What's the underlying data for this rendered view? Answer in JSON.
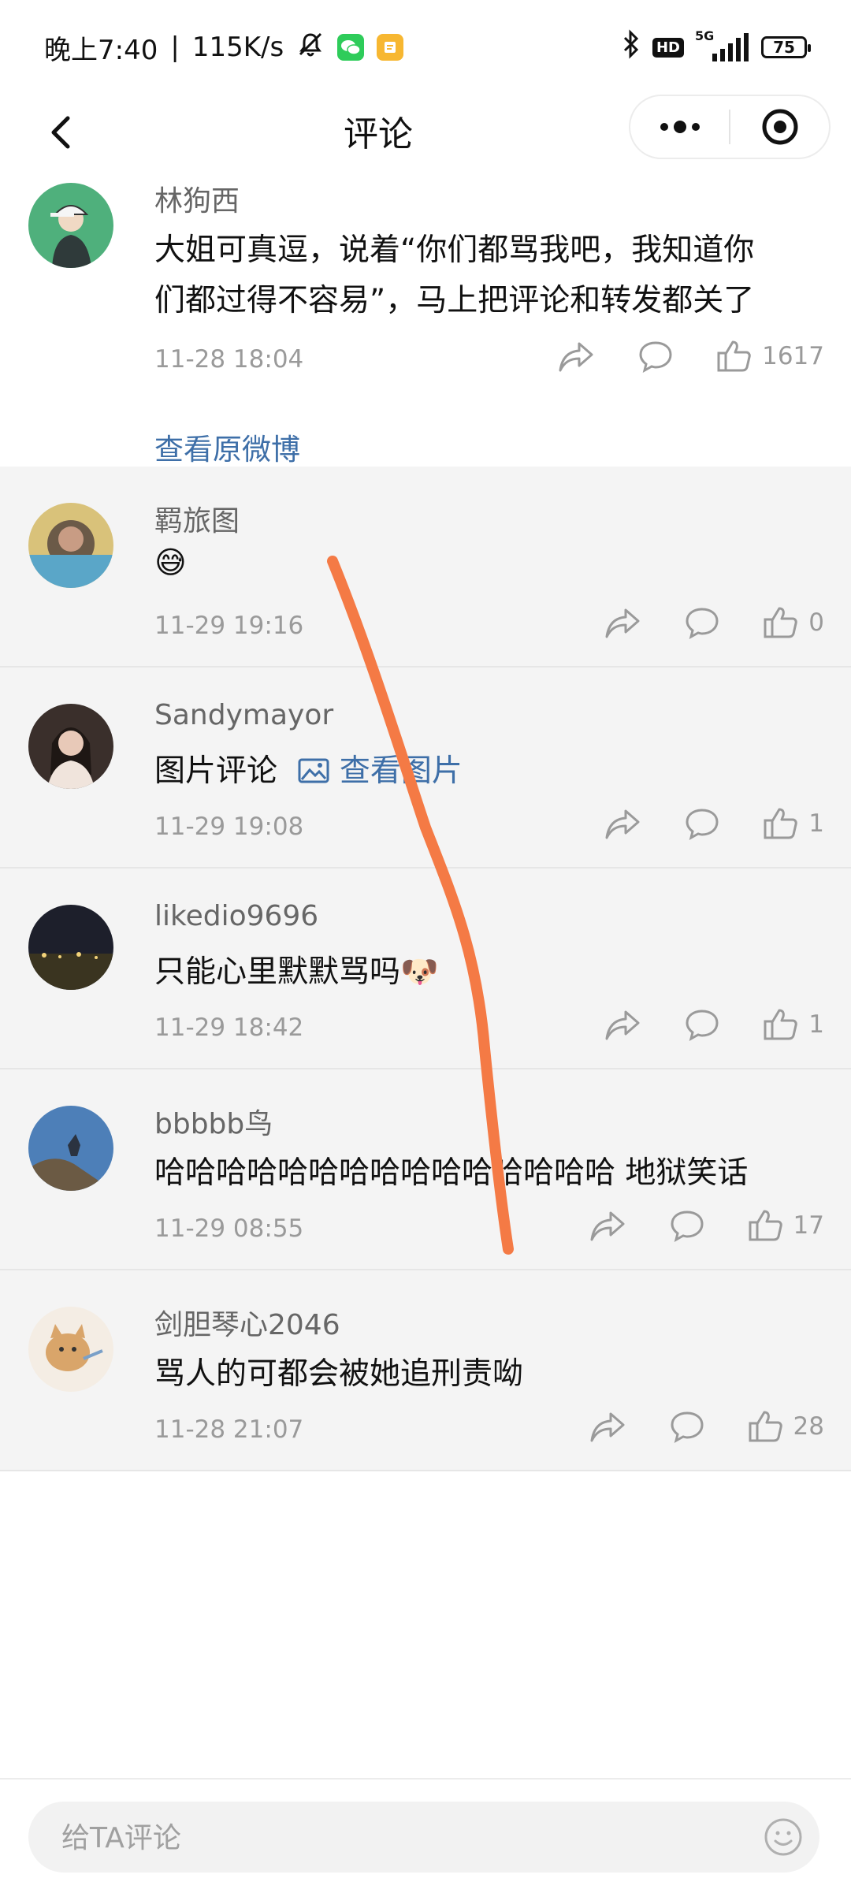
{
  "status_bar": {
    "time": "晚上7:40",
    "separator": "|",
    "network_speed": "115K/s",
    "hd": "HD",
    "signal_type": "5G",
    "battery": "75",
    "icons": [
      "mute-icon",
      "wechat-icon",
      "notes-icon",
      "bluetooth-icon",
      "signal-icon"
    ]
  },
  "nav": {
    "title": "评论",
    "back_icon": "chevron-left-icon",
    "more_icon": "more-dots-icon",
    "close_icon": "target-circle-icon"
  },
  "main_comment": {
    "username": "林狗西",
    "content_line1": "大姐可真逗，说着“你们都骂我吧，我知道你",
    "content_line2": "们都过得不容易”，马上把评论和转发都关了",
    "time": "11-28 18:04",
    "likes": "1617",
    "view_original": "查看原微博"
  },
  "replies": [
    {
      "username": "羁旅图",
      "content": "😅",
      "time": "11-29 19:16",
      "likes": "0"
    },
    {
      "username": "Sandymayor",
      "content": "图片评论",
      "content_link": "查看图片",
      "time": "11-29 19:08",
      "likes": "1"
    },
    {
      "username": "likedio9696",
      "content": "只能心里默默骂吗",
      "emoji": "🐶",
      "time": "11-29 18:42",
      "likes": "1"
    },
    {
      "username": "bbbbb鸟",
      "content": "哈哈哈哈哈哈哈哈哈哈哈哈哈哈哈 地狱笑话",
      "time": "11-29 08:55",
      "likes": "17"
    },
    {
      "username": "剑胆琴心2046",
      "content": "骂人的可都会被她追刑责呦",
      "time": "11-28 21:07",
      "likes": "28"
    }
  ],
  "bottom": {
    "placeholder": "给TA评论",
    "emoji_icon": "smiley-icon"
  },
  "colors": {
    "link": "#3e6fa8",
    "muted": "#9a9a9a",
    "reply_bg": "#f4f4f4",
    "annotation_stroke": "#f47a45"
  }
}
